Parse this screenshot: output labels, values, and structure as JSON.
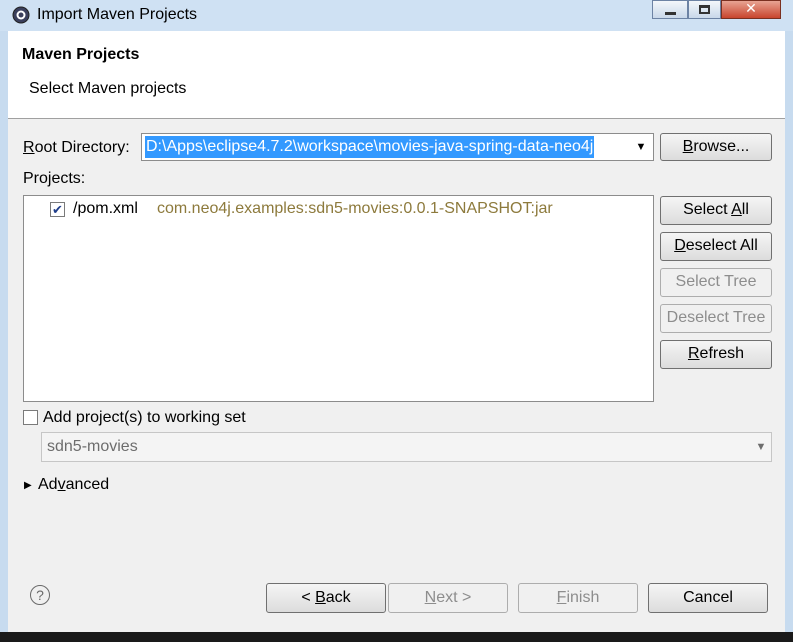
{
  "window": {
    "title": "Import Maven Projects",
    "minimize_icon": "minimize-icon",
    "maximize_icon": "maximize-icon",
    "close_icon": "close-icon"
  },
  "header": {
    "title": "Maven Projects",
    "subtitle": "Select Maven projects"
  },
  "root_directory": {
    "label_accel": "R",
    "label_rest": "oot Directory:",
    "value": "D:\\Apps\\eclipse4.7.2\\workspace\\movies-java-spring-data-neo4j",
    "browse_accel": "B",
    "browse_rest": "rowse..."
  },
  "projects": {
    "label": "Projects:",
    "items": [
      {
        "checked": true,
        "path": "/pom.xml",
        "artifact": "com.neo4j.examples:sdn5-movies:0.0.1-SNAPSHOT:jar"
      }
    ]
  },
  "side_buttons": {
    "select_all_pre": "Select ",
    "select_all_accel": "A",
    "select_all_post": "ll",
    "deselect_all_accel": "D",
    "deselect_all_rest": "eselect All",
    "select_tree": "Select Tree",
    "deselect_tree": "Deselect Tree",
    "refresh_accel": "R",
    "refresh_rest": "efresh"
  },
  "working_set": {
    "checkbox_label": "Add project(s) to working set",
    "value": "sdn5-movies"
  },
  "advanced": {
    "pre": "Ad",
    "accel": "v",
    "post": "anced"
  },
  "footer": {
    "help_icon": "help-icon",
    "back_pre": "< ",
    "back_accel": "B",
    "back_post": "ack",
    "next_accel": "N",
    "next_post": "ext >",
    "finish_accel": "F",
    "finish_post": "inish",
    "cancel": "Cancel"
  }
}
